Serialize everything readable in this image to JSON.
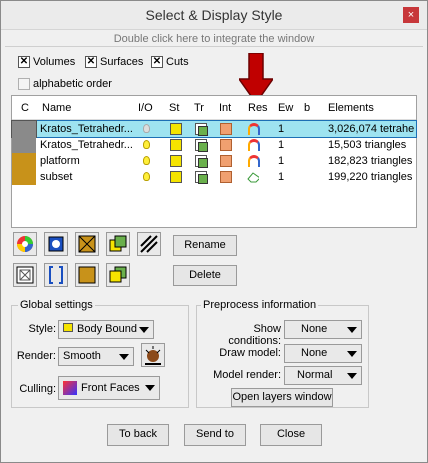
{
  "window": {
    "title": "Select & Display Style",
    "close_glyph": "×",
    "hint": "Double click here to integrate the window"
  },
  "filters": {
    "volumes": "Volumes",
    "surfaces": "Surfaces",
    "cuts": "Cuts",
    "alphabetic": "alphabetic order"
  },
  "table": {
    "headers": [
      "C",
      "Name",
      "I/O",
      "St",
      "Tr",
      "Int",
      "Res",
      "Ew",
      "b",
      "Elements"
    ],
    "rows": [
      {
        "color": "#8a8a8a",
        "name": "Kratos_Tetrahedr...",
        "io": "off",
        "ew": "1",
        "elements": "3,026,074 tetrahe",
        "res_icon": "rainbow-icon"
      },
      {
        "color": "#8a8a8a",
        "name": "Kratos_Tetrahedr...",
        "io": "on",
        "ew": "1",
        "elements": "15,503 triangles",
        "res_icon": "rainbow-icon"
      },
      {
        "color": "#c8921a",
        "name": "platform",
        "io": "on",
        "ew": "1",
        "elements": "182,823 triangles",
        "res_icon": "rainbow-icon"
      },
      {
        "color": "#c8921a",
        "name": "subset",
        "io": "on",
        "ew": "1",
        "elements": "199,220 triangles",
        "res_icon": "eraser-icon"
      }
    ]
  },
  "actions": {
    "rename": "Rename",
    "delete": "Delete"
  },
  "global": {
    "title": "Global settings",
    "style_label": "Style:",
    "style_value": "Body Bound",
    "render_label": "Render:",
    "render_value": "Smooth",
    "culling_label": "Culling:",
    "culling_value": "Front Faces"
  },
  "preprocess": {
    "title": "Preprocess information",
    "show_label": "Show conditions:",
    "show_value": "None",
    "draw_label": "Draw model:",
    "draw_value": "None",
    "model_label": "Model render:",
    "model_value": "Normal",
    "open_layers": "Open layers window"
  },
  "footer": {
    "back": "To back",
    "send": "Send to",
    "close": "Close"
  },
  "colors": {
    "selected_row": "#9ee3f0",
    "arrow": "#c00000"
  }
}
